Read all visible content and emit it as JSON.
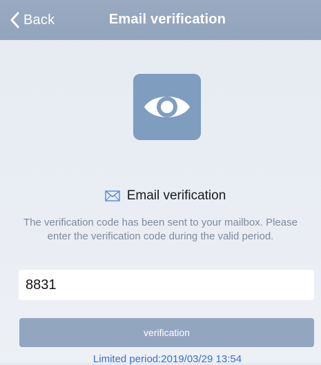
{
  "nav": {
    "back_label": "Back",
    "title": "Email verification"
  },
  "icons": {
    "back": "chevron-left-icon",
    "app": "eye-icon",
    "mail": "envelope-icon"
  },
  "section": {
    "heading": "Email verification",
    "info": "The verification code has been sent to your mailbox. Please enter the verification code during the valid period."
  },
  "form": {
    "code_value": "8831"
  },
  "actions": {
    "verify_label": "verification"
  },
  "footer": {
    "limited_period": "Limited period:2019/03/29 13:54"
  },
  "colors": {
    "navbar": "#98a9c0",
    "icon_tile": "#7e9dbf",
    "button": "#93a6bf",
    "link": "#3570cf",
    "info_text": "#7d8b9e"
  }
}
